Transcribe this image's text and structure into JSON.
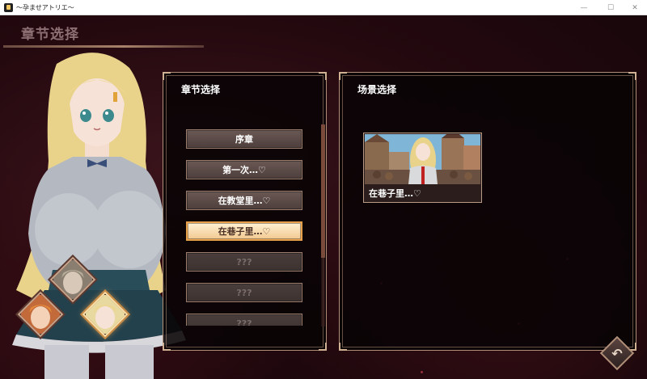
{
  "window": {
    "title": "～孕ませアトリエ～",
    "minimize": "—",
    "maximize": "☐",
    "close": "✕"
  },
  "header": {
    "title": "章节选择"
  },
  "chapter_panel": {
    "title": "章节选择",
    "items": [
      {
        "label": "序章",
        "state": "normal"
      },
      {
        "label": "第一次…♡",
        "state": "normal"
      },
      {
        "label": "在教堂里…♡",
        "state": "normal"
      },
      {
        "label": "在巷子里…♡",
        "state": "selected"
      },
      {
        "label": "???",
        "state": "locked"
      },
      {
        "label": "???",
        "state": "locked"
      },
      {
        "label": "???",
        "state": "locked"
      }
    ]
  },
  "scene_panel": {
    "title": "场景选择",
    "scenes": [
      {
        "label": "在巷子里…♡"
      }
    ]
  },
  "colors": {
    "accent": "#e8a04a",
    "panel_border": "#b08f78",
    "background": "#1a0a0e"
  },
  "icons": {
    "back": "undo-arrow-icon"
  }
}
